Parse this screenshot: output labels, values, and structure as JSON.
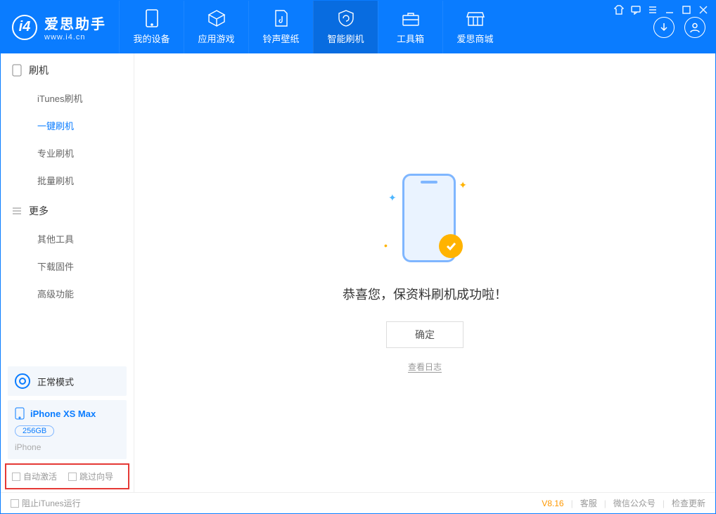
{
  "app": {
    "name": "爱思助手",
    "url": "www.i4.cn"
  },
  "nav": [
    {
      "id": "device",
      "label": "我的设备"
    },
    {
      "id": "apps",
      "label": "应用游戏"
    },
    {
      "id": "ringtone",
      "label": "铃声壁纸"
    },
    {
      "id": "flash",
      "label": "智能刷机"
    },
    {
      "id": "toolbox",
      "label": "工具箱"
    },
    {
      "id": "store",
      "label": "爱思商城"
    }
  ],
  "sidebar": {
    "group1_title": "刷机",
    "group1": [
      {
        "label": "iTunes刷机"
      },
      {
        "label": "一键刷机"
      },
      {
        "label": "专业刷机"
      },
      {
        "label": "批量刷机"
      }
    ],
    "group2_title": "更多",
    "group2": [
      {
        "label": "其他工具"
      },
      {
        "label": "下载固件"
      },
      {
        "label": "高级功能"
      }
    ],
    "mode": "正常模式",
    "device": {
      "name": "iPhone XS Max",
      "storage": "256GB",
      "subtype": "iPhone"
    },
    "auto_activate": "自动激活",
    "skip_guide": "跳过向导"
  },
  "main": {
    "success_text": "恭喜您，保资料刷机成功啦！",
    "ok_button": "确定",
    "view_log": "查看日志"
  },
  "footer": {
    "block_itunes": "阻止iTunes运行",
    "version": "V8.16",
    "link_support": "客服",
    "link_wechat": "微信公众号",
    "link_update": "检查更新"
  }
}
